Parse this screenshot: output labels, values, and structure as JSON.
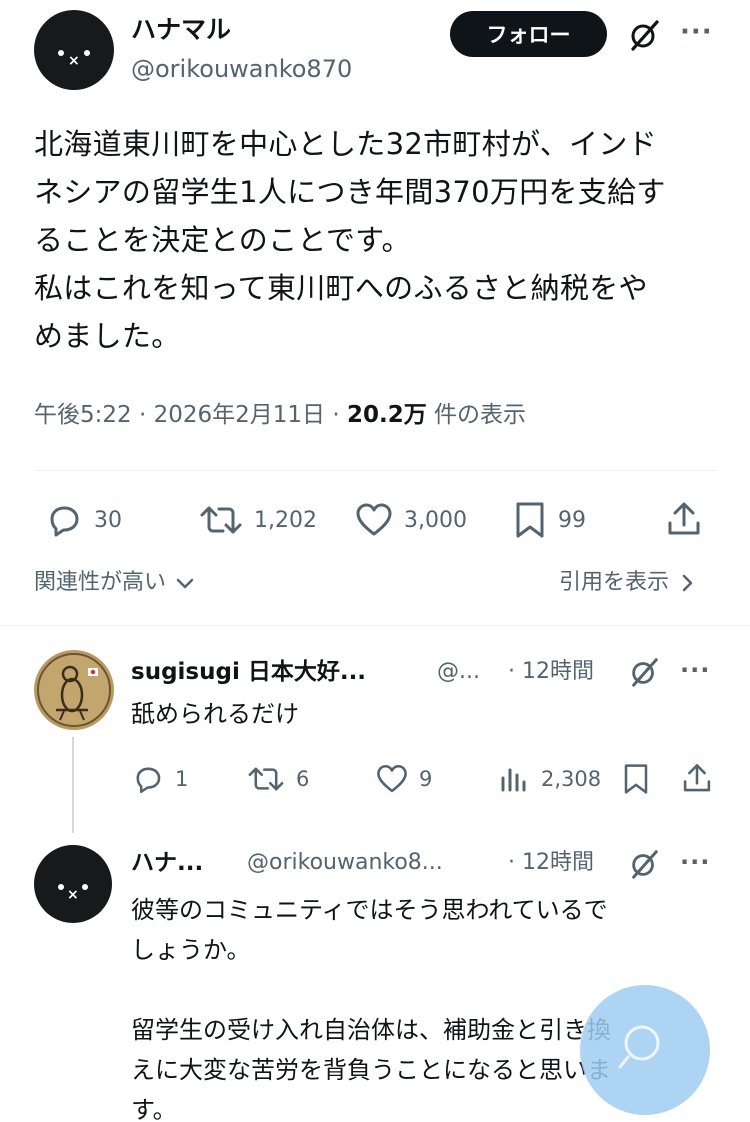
{
  "post": {
    "author_name": "ハナマル",
    "author_handle": "@orikouwanko870",
    "follow_label": "フォロー",
    "more_label": "···",
    "lines": [
      "北海道東川町を中心とした32市町村が、インド",
      "ネシアの留学生1人につき年間370万円を支給す",
      "ることを決定とのことです。",
      "私はこれを知って東川町へのふるさと納税をや",
      "めました。"
    ],
    "time": "午後5:22",
    "date": "2026年2月11日",
    "views_count": "20.2万",
    "views_label": "件の表示",
    "dot": "·"
  },
  "actions": {
    "replies": "30",
    "reposts": "1,202",
    "likes": "3,000",
    "bookmarks": "99"
  },
  "sort": {
    "relevance_label": "関連性が高い",
    "quotes_label": "引用を表示"
  },
  "replies": [
    {
      "name": "sugisugi 日本大好...",
      "handle": "@...",
      "time": "· 12時間",
      "text": "舐められるだけ",
      "replies": "1",
      "reposts": "6",
      "likes": "9",
      "views": "2,308"
    },
    {
      "name": "ハナ...",
      "handle": "@orikouwanko8...",
      "time": "· 12時間",
      "lines": [
        "彼等のコミュニティではそう思われているで",
        "しょうか。",
        "",
        "留学生の受け入れ自治体は、補助金と引き換",
        "えに大変な苦労を背負うことになると思いま",
        "す。"
      ]
    }
  ],
  "colors": {
    "text": "#0f1419",
    "muted": "#536471",
    "divider": "#eff3f4",
    "fab": "#9fcdf0"
  }
}
